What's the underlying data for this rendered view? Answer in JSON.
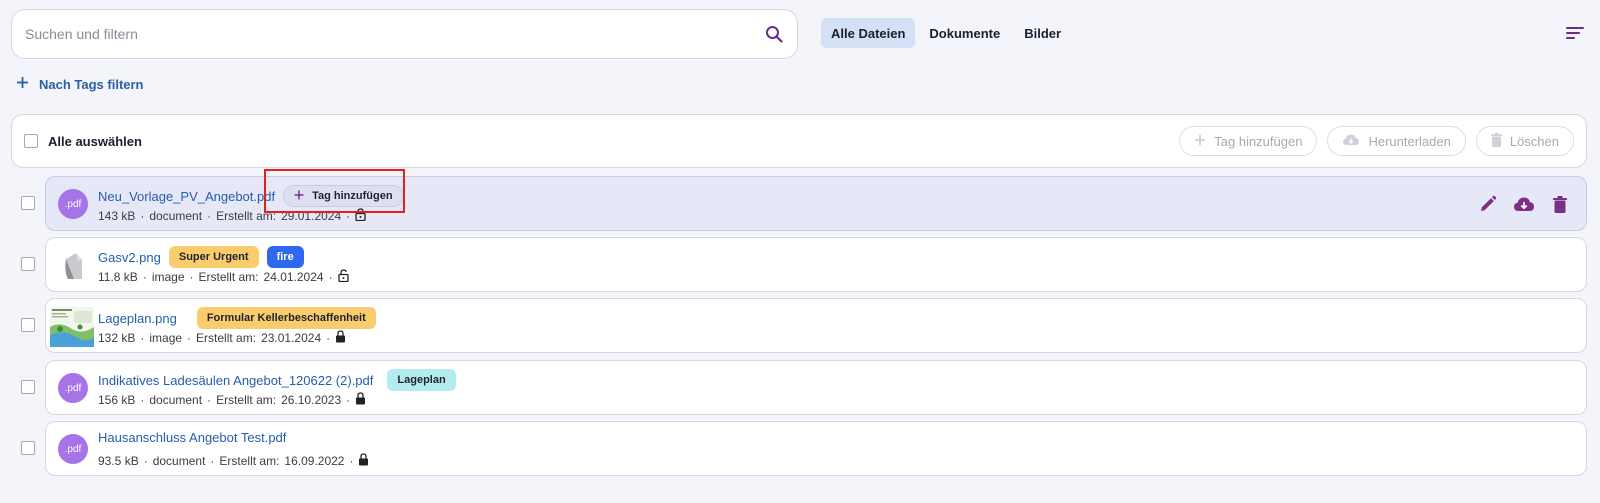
{
  "search": {
    "placeholder": "Suchen und filtern"
  },
  "tabs": [
    {
      "label": "Alle Dateien",
      "active": true
    },
    {
      "label": "Dokumente",
      "active": false
    },
    {
      "label": "Bilder",
      "active": false
    }
  ],
  "tag_filter": {
    "label": "Nach Tags filtern"
  },
  "select_bar": {
    "label": "Alle auswählen",
    "actions": [
      {
        "label": "Tag hinzufügen",
        "icon": "plus-icon"
      },
      {
        "label": "Herunterladen",
        "icon": "cloud-download-icon"
      },
      {
        "label": "Löschen",
        "icon": "trash-icon"
      }
    ]
  },
  "files": [
    {
      "name": "Neu_Vorlage_PV_Angebot.pdf",
      "thumb": ".pdf",
      "add_tag_label": "Tag hinzufügen",
      "size": "143 kB",
      "type": "document",
      "created_label": "Erstellt am:",
      "created": "29.01.2024",
      "locked": false
    },
    {
      "name": "Gasv2.png",
      "thumb": "image",
      "tags": [
        {
          "label": "Super Urgent",
          "color": "#fbcc6b"
        },
        {
          "label": "fire",
          "color": "#2f68ee"
        }
      ],
      "size": "11.8 kB",
      "type": "image",
      "created_label": "Erstellt am:",
      "created": "24.01.2024",
      "locked": false
    },
    {
      "name": "Lageplan.png",
      "thumb": "image",
      "tags": [
        {
          "label": "Formular Kellerbeschaffenheit",
          "color": "#fbcc6b"
        }
      ],
      "size": "132 kB",
      "type": "image",
      "created_label": "Erstellt am:",
      "created": "23.01.2024",
      "locked": true
    },
    {
      "name": "Indikatives Ladesäulen Angebot_120622 (2).pdf",
      "thumb": ".pdf",
      "tags": [
        {
          "label": "Lageplan",
          "color": "#b2ecef"
        }
      ],
      "size": "156 kB",
      "type": "document",
      "created_label": "Erstellt am:",
      "created": "26.10.2023",
      "locked": true
    },
    {
      "name": "Hausanschluss Angebot Test.pdf",
      "thumb": ".pdf",
      "size": "93.5 kB",
      "type": "document",
      "created_label": "Erstellt am:",
      "created": "16.09.2022",
      "locked": true
    }
  ],
  "colors": {
    "accent": "#6f2a8a",
    "link": "#255eac",
    "pdf": "#a773e9",
    "highlight": "#e2211b"
  }
}
